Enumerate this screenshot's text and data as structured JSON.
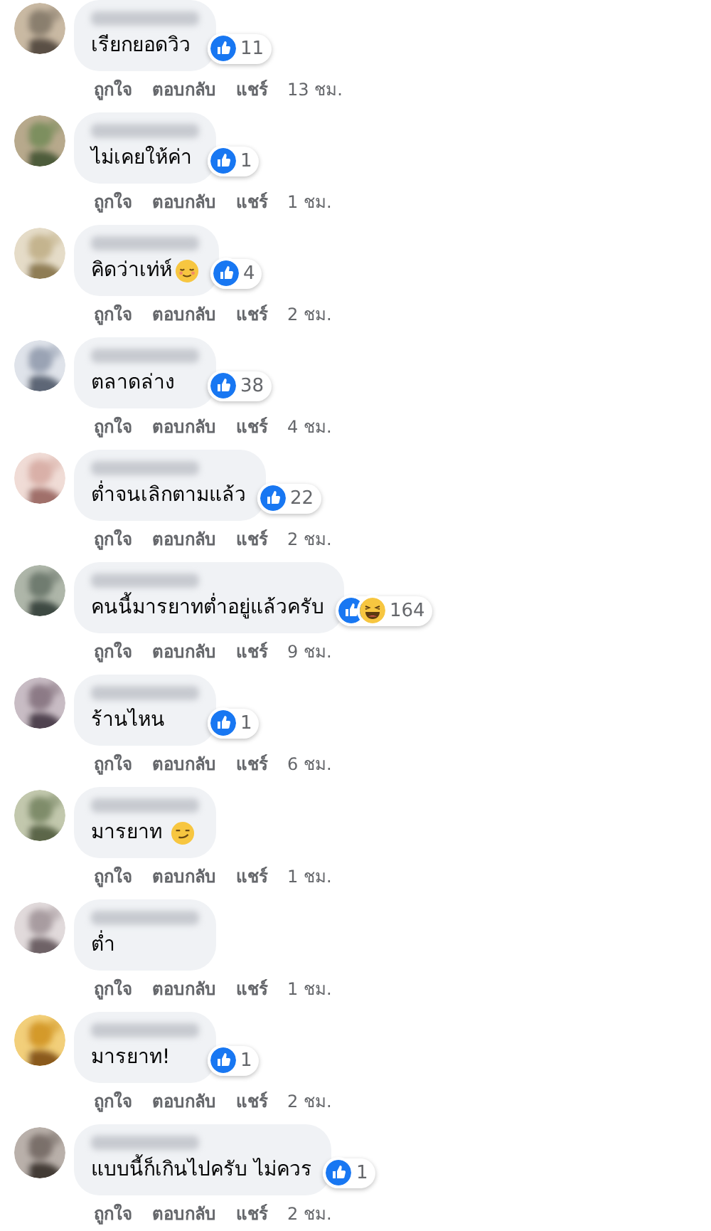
{
  "comments": [
    {
      "text": "เรียกยอดวิว",
      "reactions": [
        {
          "kind": "like"
        }
      ],
      "count": "11",
      "actions": [
        "ถูกใจ",
        "ตอบกลับ",
        "แชร์"
      ],
      "time": "13 ชม."
    },
    {
      "text": "ไม่เคยให้ค่า",
      "reactions": [
        {
          "kind": "like"
        }
      ],
      "count": "1",
      "actions": [
        "ถูกใจ",
        "ตอบกลับ",
        "แชร์"
      ],
      "time": "1 ชม."
    },
    {
      "text": "คิดว่าเท่ห์",
      "emoji": {
        "kind": "relieved"
      },
      "reactions": [
        {
          "kind": "like"
        }
      ],
      "count": "4",
      "actions": [
        "ถูกใจ",
        "ตอบกลับ",
        "แชร์"
      ],
      "time": "2 ชม."
    },
    {
      "text": "ตลาดล่าง",
      "reactions": [
        {
          "kind": "like"
        }
      ],
      "count": "38",
      "actions": [
        "ถูกใจ",
        "ตอบกลับ",
        "แชร์"
      ],
      "time": "4 ชม."
    },
    {
      "text": "ต่ำจนเลิกตามแล้ว",
      "reactions": [
        {
          "kind": "like"
        }
      ],
      "count": "22",
      "actions": [
        "ถูกใจ",
        "ตอบกลับ",
        "แชร์"
      ],
      "time": "2 ชม."
    },
    {
      "text": "คนนี้มารยาทต่ำอยู่แล้วครับ",
      "reactions": [
        {
          "kind": "like"
        },
        {
          "kind": "haha"
        }
      ],
      "count": "164",
      "actions": [
        "ถูกใจ",
        "ตอบกลับ",
        "แชร์"
      ],
      "time": "9 ชม."
    },
    {
      "text": "ร้านไหน",
      "reactions": [
        {
          "kind": "like"
        }
      ],
      "count": "1",
      "actions": [
        "ถูกใจ",
        "ตอบกลับ",
        "แชร์"
      ],
      "time": "6 ชม."
    },
    {
      "text": "มารยาท",
      "emoji": {
        "kind": "smirk"
      },
      "actions": [
        "ถูกใจ",
        "ตอบกลับ",
        "แชร์"
      ],
      "time": "1 ชม."
    },
    {
      "text": "ต่ำ",
      "actions": [
        "ถูกใจ",
        "ตอบกลับ",
        "แชร์"
      ],
      "time": "1 ชม."
    },
    {
      "text": "มารยาท!",
      "reactions": [
        {
          "kind": "like"
        }
      ],
      "count": "1",
      "actions": [
        "ถูกใจ",
        "ตอบกลับ",
        "แชร์"
      ],
      "time": "2 ชม."
    },
    {
      "text": "แบบนี้ก็เกินไปครับ ไม่ควร",
      "reactions": [
        {
          "kind": "like"
        }
      ],
      "count": "1",
      "actions": [
        "ถูกใจ",
        "ตอบกลับ",
        "แชร์"
      ],
      "time": "2 ชม."
    }
  ]
}
